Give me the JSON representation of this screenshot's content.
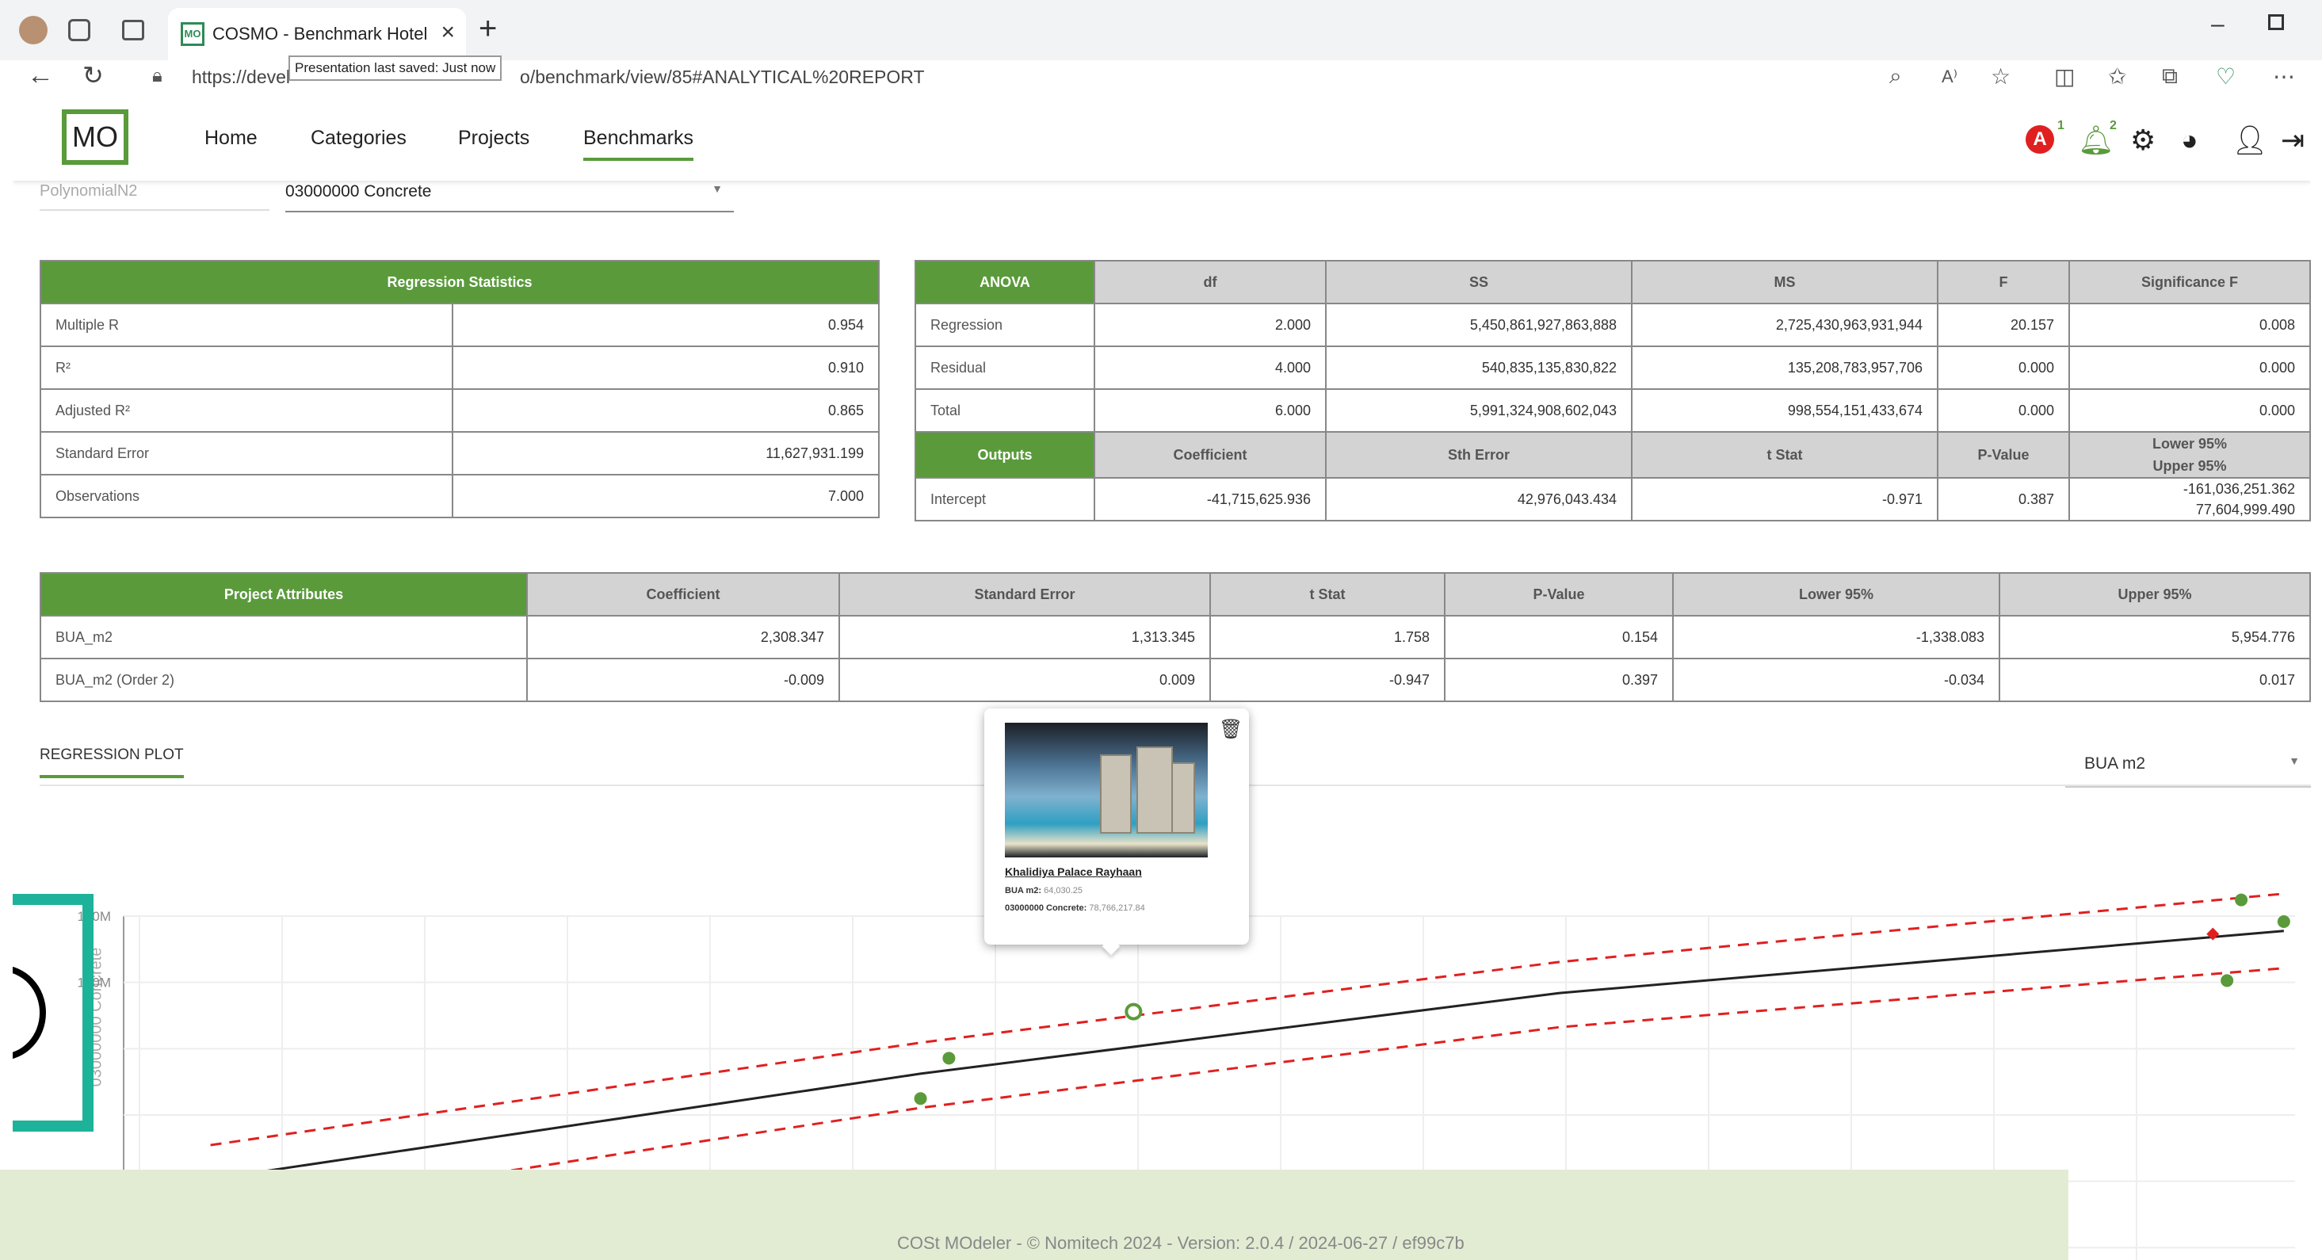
{
  "browser": {
    "tab_title": "COSMO - Benchmark Hotel by Flo",
    "favicon": "MO",
    "url": "https://devel...nomitech.com/demo-cosmo/benchmark/view/85#ANALYTICAL%20REPORT",
    "url_display": "https://devel",
    "url_display_end": "o/benchmark/view/85#ANALYTICAL%20REPORT",
    "tooltip": "Presentation last saved: Just now"
  },
  "app": {
    "logo": "MO",
    "nav": [
      "Home",
      "Categories",
      "Projects",
      "Benchmarks"
    ],
    "alert_badge": "A",
    "alert_count": "1",
    "bell_count": "2"
  },
  "filters": {
    "model": "PolynomialN2",
    "category": "03000000 Concrete"
  },
  "regression_statistics": {
    "header": "Regression Statistics",
    "rows": [
      {
        "label": "Multiple R",
        "value": "0.954"
      },
      {
        "label": "R²",
        "value": "0.910"
      },
      {
        "label": "Adjusted R²",
        "value": "0.865"
      },
      {
        "label": "Standard Error",
        "value": "11,627,931.199"
      },
      {
        "label": "Observations",
        "value": "7.000"
      }
    ]
  },
  "anova": {
    "headers": [
      "ANOVA",
      "df",
      "SS",
      "MS",
      "F",
      "Significance F"
    ],
    "rows": [
      [
        "Regression",
        "2.000",
        "5,450,861,927,863,888",
        "2,725,430,963,931,944",
        "20.157",
        "0.008"
      ],
      [
        "Residual",
        "4.000",
        "540,835,135,830,822",
        "135,208,783,957,706",
        "0.000",
        "0.000"
      ],
      [
        "Total",
        "6.000",
        "5,991,324,908,602,043",
        "998,554,151,433,674",
        "0.000",
        "0.000"
      ]
    ],
    "output_headers": [
      "Outputs",
      "Coefficient",
      "Sth Error",
      "t Stat",
      "P-Value",
      "Lower 95%",
      "Upper 95%"
    ],
    "intercept": [
      "Intercept",
      "-41,715,625.936",
      "42,976,043.434",
      "-0.971",
      "0.387",
      "-161,036,251.362",
      "77,604,999.490"
    ]
  },
  "project_attributes": {
    "headers": [
      "Project Attributes",
      "Coefficient",
      "Standard Error",
      "t Stat",
      "P-Value",
      "Lower 95%",
      "Upper 95%"
    ],
    "rows": [
      [
        "BUA_m2",
        "2,308.347",
        "1,313.345",
        "1.758",
        "0.154",
        "-1,338.083",
        "5,954.776"
      ],
      [
        "BUA_m2 (Order 2)",
        "-0.009",
        "0.009",
        "-0.947",
        "0.397",
        "-0.034",
        "0.017"
      ]
    ]
  },
  "plot": {
    "tab": "REGRESSION PLOT",
    "axis_select": "BUA m2",
    "y_axis_label": "03000000 Concrete",
    "y_ticks": [
      "120M",
      "100M",
      "",
      "",
      "",
      "20M",
      "0"
    ],
    "colors": {
      "point": "#5a9a3b",
      "fit": "#222222",
      "bounds": "#e02020",
      "predicted": "#e02020"
    }
  },
  "chart_data": {
    "type": "scatter",
    "ylabel": "03000000 Concrete",
    "xlabel": "BUA m2",
    "ylim": [
      0,
      120
    ],
    "xlim": [
      0,
      149
    ],
    "points": [
      {
        "x": 5,
        "y": 25
      },
      {
        "x": 55,
        "y": 51
      },
      {
        "x": 57,
        "y": 64
      },
      {
        "x": 70,
        "y": 79
      },
      {
        "x": 148,
        "y": 115
      },
      {
        "x": 147,
        "y": 89
      },
      {
        "x": 151,
        "y": 108
      }
    ],
    "predicted": [
      {
        "x": 146,
        "y": 104
      }
    ],
    "fit": [
      {
        "x": 5,
        "y": 25
      },
      {
        "x": 55,
        "y": 59
      },
      {
        "x": 100,
        "y": 85
      },
      {
        "x": 151,
        "y": 105
      }
    ],
    "upper": [
      {
        "x": 5,
        "y": 36
      },
      {
        "x": 55,
        "y": 69
      },
      {
        "x": 100,
        "y": 95
      },
      {
        "x": 151,
        "y": 117
      }
    ],
    "lower": [
      {
        "x": 5,
        "y": 13
      },
      {
        "x": 55,
        "y": 48
      },
      {
        "x": 100,
        "y": 74
      },
      {
        "x": 151,
        "y": 93
      }
    ],
    "tooltip": {
      "name": "Khalidiya Palace Rayhaan",
      "bua_label": "BUA m2:",
      "bua_value": "64,030.25",
      "concrete_label": "03000000 Concrete:",
      "concrete_value": "78,766,217.84"
    }
  },
  "footer": "COSt MOdeler - © Nomitech 2024 - Version: 2.0.4 / 2024-06-27 / ef99c7b"
}
